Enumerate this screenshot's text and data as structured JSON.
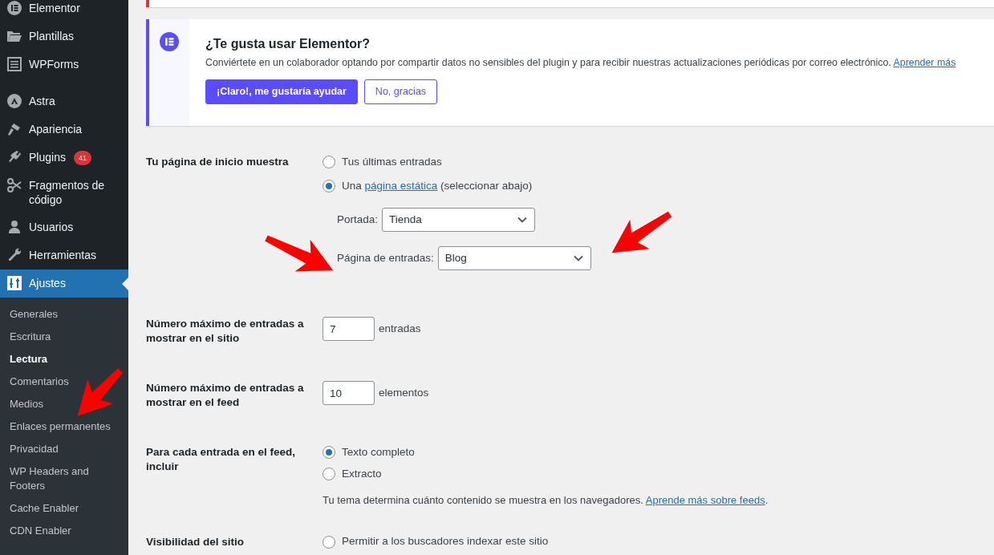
{
  "sidebar": {
    "menu_groups": [
      [
        {
          "label": "Elementor",
          "selected": false
        },
        {
          "label": "Plantillas",
          "selected": false
        },
        {
          "label": "WPForms",
          "selected": false
        }
      ],
      [
        {
          "label": "Astra",
          "selected": false
        },
        {
          "label": "Apariencia",
          "selected": false
        },
        {
          "label": "Plugins",
          "selected": false,
          "badge": "41"
        },
        {
          "label": "Fragmentos de código",
          "selected": false
        },
        {
          "label": "Usuarios",
          "selected": false
        },
        {
          "label": "Herramientas",
          "selected": false
        },
        {
          "label": "Ajustes",
          "selected": true
        }
      ]
    ],
    "submenu": [
      {
        "label": "Generales",
        "selected": false
      },
      {
        "label": "Escritura",
        "selected": false
      },
      {
        "label": "Lectura",
        "selected": true
      },
      {
        "label": "Comentarios",
        "selected": false
      },
      {
        "label": "Medios",
        "selected": false
      },
      {
        "label": "Enlaces permanentes",
        "selected": false
      },
      {
        "label": "Privacidad",
        "selected": false
      },
      {
        "label": "WP Headers and Footers",
        "selected": false
      },
      {
        "label": "Cache Enabler",
        "selected": false
      },
      {
        "label": "CDN Enabler",
        "selected": false
      }
    ]
  },
  "notice": {
    "title": "¿Te gusta usar Elementor?",
    "text": "Conviértete en un colaborador optando por compartir datos no sensibles del plugin y para recibir nuestras actualizaciones periódicas por correo electrónico.",
    "link": "Aprender más",
    "buttons": [
      {
        "label": "¡Claro!, me gustaría ayudar",
        "kind": "primary"
      },
      {
        "label": "No, gracias",
        "kind": "secondary"
      }
    ]
  },
  "front_page": {
    "label": "Tu página de inicio muestra",
    "options": [
      {
        "text": "Tus últimas entradas",
        "selected": false
      },
      {
        "text": "Una",
        "link": "página estática",
        "suffix": "(seleccionar abajo)",
        "selected": true
      }
    ],
    "selects": [
      {
        "label": "Portada:",
        "value": "Tienda"
      },
      {
        "label": "Página de entradas:",
        "value": "Blog"
      }
    ]
  },
  "numbers": [
    {
      "label": "Número máximo de entradas a mostrar en el sitio",
      "value": "7",
      "unit": "entradas"
    },
    {
      "label": "Número máximo de entradas a mostrar en el feed",
      "value": "10",
      "unit": "elementos"
    }
  ],
  "feed_content": {
    "label": "Para cada entrada en el feed, incluir",
    "options": [
      {
        "text": "Texto completo",
        "selected": true
      },
      {
        "text": "Extracto",
        "selected": false
      }
    ],
    "description": "Tu tema determina cuánto contenido se muestra en los navegadores.",
    "link": "Aprende más sobre feeds",
    "link_suffix": "."
  },
  "visibility": {
    "label": "Visibilidad del sitio",
    "options": [
      {
        "text": "Permitir a los buscadores indexar este sitio",
        "selected": false
      }
    ]
  }
}
